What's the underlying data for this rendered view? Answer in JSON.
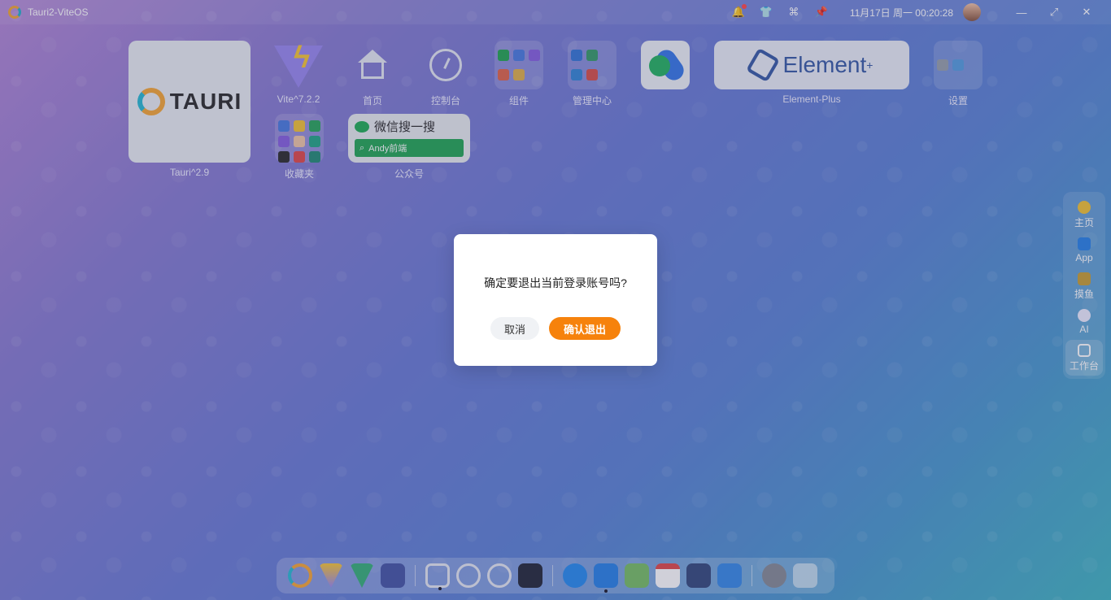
{
  "titlebar": {
    "app_name": "Tauri2-ViteOS",
    "clock": "11月17日 周一 00:20:28"
  },
  "desktop": {
    "tauri": {
      "label": "Tauri^2.9",
      "word": "TAURI"
    },
    "vite": {
      "label": "Vite^7.2.2"
    },
    "home": {
      "label": "首页"
    },
    "console": {
      "label": "控制台"
    },
    "components": {
      "label": "组件"
    },
    "admin": {
      "label": "管理中心"
    },
    "element": {
      "label": "Element-Plus",
      "word": "Element"
    },
    "settings": {
      "label": "设置"
    },
    "favorites": {
      "label": "收藏夹"
    },
    "wechat": {
      "label": "公众号",
      "title": "微信搜一搜",
      "search": "Andy前端"
    }
  },
  "dialog": {
    "message": "确定要退出当前登录账号吗?",
    "cancel": "取消",
    "confirm": "确认退出"
  },
  "side_dock": {
    "items": [
      {
        "label": "主页"
      },
      {
        "label": "App"
      },
      {
        "label": "摸鱼"
      },
      {
        "label": "AI"
      },
      {
        "label": "工作台"
      }
    ]
  },
  "colors": {
    "accent": "#f6820c"
  }
}
